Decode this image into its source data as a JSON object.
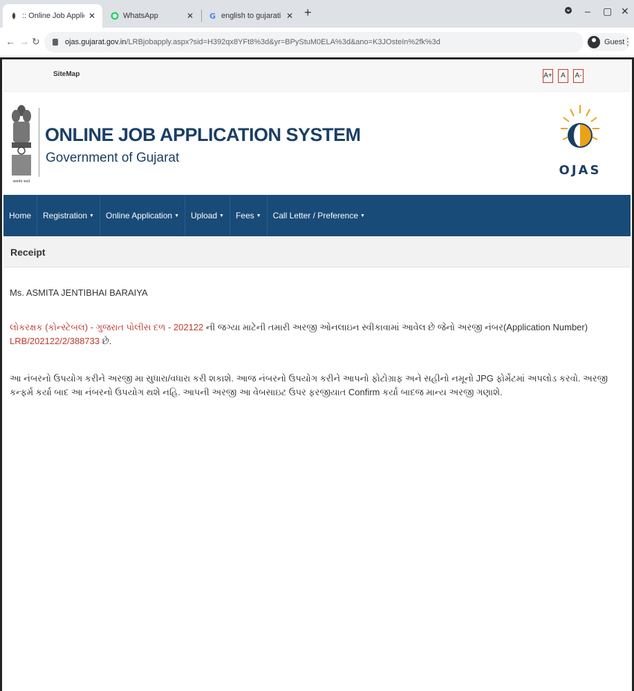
{
  "browser": {
    "tabs": [
      {
        "title": ":: Online Job Application System",
        "active": true
      },
      {
        "title": "WhatsApp",
        "active": false
      },
      {
        "title": "english to gujarati - Google Search",
        "active": false
      }
    ],
    "url_host": "ojas.gujarat.gov.in",
    "url_path": "/LRBjobapply.aspx?sid=H392qx8YFt8%3d&yr=BPyStuM0ELA%3d&ano=K3JOsteIn%2fk%3d",
    "profile_label": "Guest"
  },
  "page": {
    "sitemap": "SiteMap",
    "font_sizes": [
      "A+",
      "A",
      "A-"
    ],
    "header": {
      "title": "ONLINE JOB APPLICATION SYSTEM",
      "subtitle": "Government of Gujarat",
      "emblem_caption": "सत्यमेव जयते",
      "logo_text": "OJAS"
    },
    "nav": [
      {
        "label": "Home",
        "has_menu": false
      },
      {
        "label": "Registration",
        "has_menu": true
      },
      {
        "label": "Online Application",
        "has_menu": true
      },
      {
        "label": "Upload",
        "has_menu": true
      },
      {
        "label": "Fees",
        "has_menu": true
      },
      {
        "label": "Call Letter / Preference",
        "has_menu": true
      }
    ],
    "section_title": "Receipt",
    "applicant_name": "Ms. ASMITA JENTIBHAI BARAIYA",
    "post_name": "લોકરક્ષક (કોન્સ્ટેબલ) - ગુજરાત પોલીસ દળ - 202122",
    "msg_mid": " ની જગ્યા માટેની તમારી અરજી ઓનલાઇન સ્વીકાવામાં આવેલ છે જેનો અરજી નંબર(Application Number) ",
    "application_number": "LRB/202122/2/388733",
    "msg_end": " છે.",
    "instructions": "આ નંબરનો ઉપયોગ કરીને અરજી મા સુધારા/વધારા કરી શકાશે. આજ નંબરનો ઉપયોગ કરીને આપનો ફોટોગ્રાફ અને સહીનો નમૂનો JPG ફોર્મેટમાં અપલોડ કરવો. અરજી કન્ફર્મ કર્યા બાદ આ નંબરનો ઉપયોગ થશે નહિ. આપની અરજી આ વેબસાઇટ ઉપર ફરજીયાત Confirm કર્યા બાદજ માન્ય અરજી ગણાશે.",
    "colors": {
      "navbar": "#194b79",
      "header_text": "#1a3f66",
      "highlight": "#c0392b"
    }
  }
}
